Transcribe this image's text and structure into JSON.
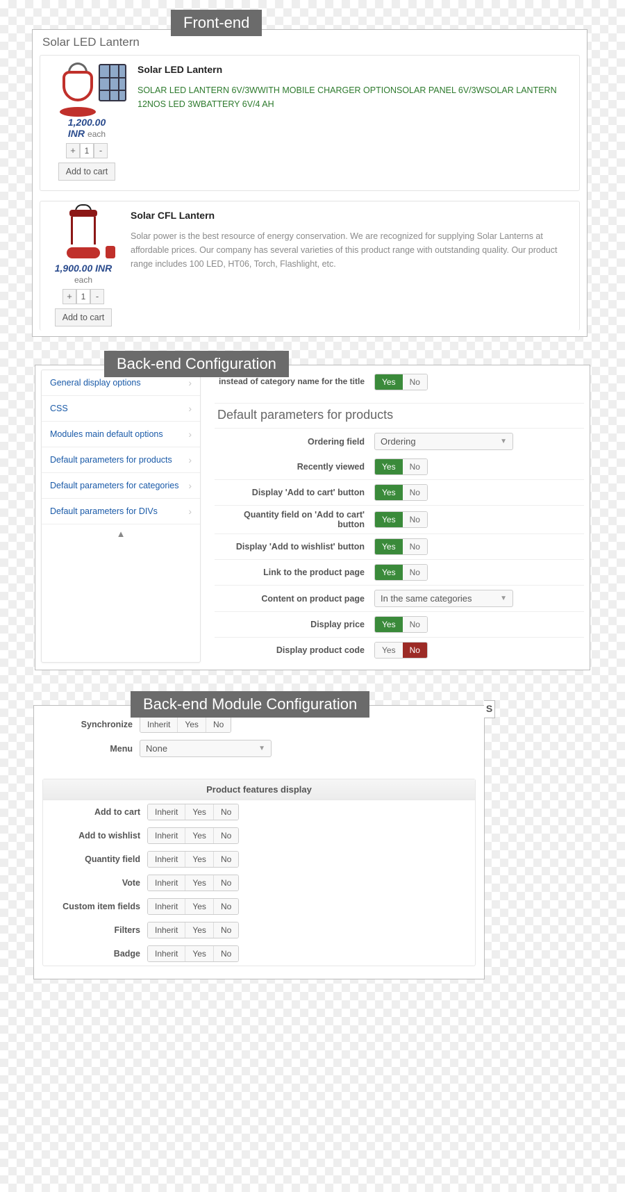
{
  "frontend": {
    "tag": "Front-end",
    "panel_title": "Solar LED Lantern",
    "add_to_cart": "Add to cart",
    "each": "each",
    "qty": "1",
    "products": [
      {
        "name": "Solar LED Lantern",
        "desc": "SOLAR LED LANTERN 6V/3WWITH MOBILE CHARGER OPTIONSOLAR PANEL 6V/3WSOLAR LANTERN 12NOS LED 3WBATTERY 6V/4 AH",
        "price": "1,200.00 INR"
      },
      {
        "name": "Solar CFL Lantern",
        "desc": "Solar power is the best resource of energy conservation. We are recognized for supplying Solar Lanterns at affordable prices. Our company has several varieties of this product range with outstanding quality. Our product range includes 100 LED, HT06, Torch, Flashlight, etc.",
        "price": "1,900.00 INR"
      }
    ]
  },
  "backend": {
    "tag": "Back-end Configuration",
    "sidebar": [
      "General display options",
      "CSS",
      "Modules main default options",
      "Default parameters for products",
      "Default parameters for categories",
      "Default parameters for DIVs"
    ],
    "top_row": {
      "label": "instead of category name for the title",
      "yes": "Yes",
      "no": "No",
      "active": "yes"
    },
    "section_title": "Default parameters for products",
    "ordering_label": "Ordering field",
    "ordering_value": "Ordering",
    "content_label": "Content on product page",
    "content_value": "In the same categories",
    "yn_common": {
      "yes": "Yes",
      "no": "No"
    },
    "rows": [
      {
        "label": "Recently viewed",
        "active": "yes"
      },
      {
        "label": "Display 'Add to cart' button",
        "active": "yes"
      },
      {
        "label": "Quantity field on 'Add to cart' button",
        "active": "yes"
      },
      {
        "label": "Display 'Add to wishlist' button",
        "active": "yes"
      },
      {
        "label": "Link to the product page",
        "active": "yes"
      }
    ],
    "price_row": {
      "label": "Display price",
      "active": "yes"
    },
    "code_row": {
      "label": "Display product code",
      "active": "no"
    }
  },
  "module": {
    "tag": "Back-end Module Configuration",
    "sync_label": "Synchronize",
    "menu_label": "Menu",
    "menu_value": "None",
    "inherit": "Inherit",
    "yes": "Yes",
    "no": "No",
    "edge": "S",
    "fieldset_title": "Product features display",
    "rows": [
      {
        "label": "Add to cart",
        "active": "yes"
      },
      {
        "label": "Add to wishlist",
        "active": "yes"
      },
      {
        "label": "Quantity field",
        "active": "yes"
      },
      {
        "label": "Vote",
        "active": "yes"
      },
      {
        "label": "Custom item fields",
        "active": "yes"
      },
      {
        "label": "Filters",
        "active": "inherit"
      },
      {
        "label": "Badge",
        "active": "yes"
      }
    ]
  }
}
